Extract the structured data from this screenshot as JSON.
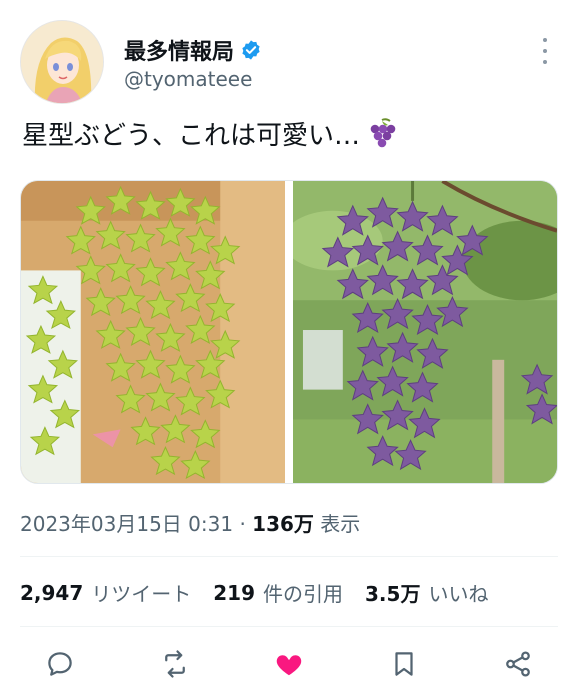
{
  "user": {
    "display_name": "最多情報局",
    "handle": "@tyomateee",
    "verified": true,
    "verified_color": "#1d9bf0"
  },
  "tweet": {
    "text": "星型ぶどう、これは可愛い…",
    "emoji_icon": "grapes-icon"
  },
  "media": {
    "photos": [
      {
        "name": "green-star-grapes-photo"
      },
      {
        "name": "purple-star-grapes-photo"
      }
    ]
  },
  "meta": {
    "timestamp": "2023年03月15日 0:31",
    "separator": "·",
    "views_count": "136万",
    "views_label": "表示"
  },
  "stats": {
    "retweets_count": "2,947",
    "retweets_label": "リツイート",
    "quotes_count": "219",
    "quotes_label": "件の引用",
    "likes_count": "3.5万",
    "likes_label": "いいね"
  },
  "actions": {
    "icons": [
      "reply-icon",
      "retweet-icon",
      "like-icon",
      "bookmark-icon",
      "share-icon"
    ],
    "like_color": "#f91880",
    "icon_color": "#536471"
  }
}
